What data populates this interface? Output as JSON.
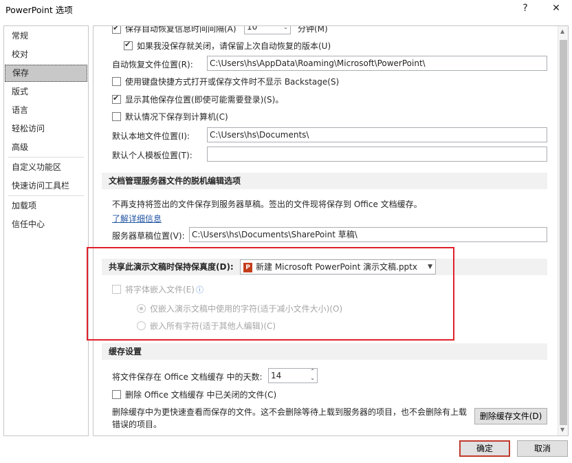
{
  "window": {
    "title": "PowerPoint 选项",
    "help": "?",
    "close": "✕"
  },
  "sidebar": {
    "items": [
      "常规",
      "校对",
      "保存",
      "版式",
      "语言",
      "轻松访问",
      "高级",
      "自定义功能区",
      "快速访问工具栏",
      "加载项",
      "信任中心"
    ],
    "selected": 2
  },
  "save": {
    "autorecover_label": "保存自动恢复信息时间间隔(A)",
    "autorecover_value": "10",
    "autorecover_unit": "分钟(M)",
    "keep_last_label": "如果我没保存就关闭，请保留上次自动恢复的版本(U)",
    "autorecover_location_label": "自动恢复文件位置(R):",
    "autorecover_location_value": "C:\\Users\\hs\\AppData\\Roaming\\Microsoft\\PowerPoint\\",
    "no_backstage_label": "使用键盘快捷方式打开或保存文件时不显示 Backstage(S)",
    "show_additional_label": "显示其他保存位置(即使可能需要登录)(S)。",
    "default_computer_label": "默认情况下保存到计算机(C)",
    "default_local_label": "默认本地文件位置(I):",
    "default_local_value": "C:\\Users\\hs\\Documents\\",
    "default_template_label": "默认个人模板位置(T):",
    "default_template_value": ""
  },
  "offline": {
    "heading": "文档管理服务器文件的脱机编辑选项",
    "desc": "不再支持将签出的文件保存到服务器草稿。签出的文件现将保存到 Office 文档缓存。",
    "link": "了解详细信息",
    "drafts_label": "服务器草稿位置(V):",
    "drafts_value": "C:\\Users\\hs\\Documents\\SharePoint 草稿\\"
  },
  "fidelity": {
    "heading": "共享此演示文稿时保持保真度(D):",
    "selected_file": "新建 Microsoft PowerPoint 演示文稿.pptx",
    "embed_label": "将字体嵌入文件(E)",
    "info_icon": "ⓘ",
    "embed_used_label": "仅嵌入演示文稿中使用的字符(适于减小文件大小)(O)",
    "embed_all_label": "嵌入所有字符(适于其他人编辑)(C)"
  },
  "cache": {
    "heading": "缓存设置",
    "days_label": "将文件保存在 Office 文档缓存 中的天数:",
    "days_value": "14",
    "delete_closed_label": "删除 Office 文档缓存 中已关闭的文件(C)",
    "desc_line1": "删除缓存中为更快速查看而保存的文件。这不会删除等待上载到服务器的项目，也不会删除有上载",
    "desc_line2": "错误的项目。",
    "delete_button": "删除缓存文件(D)"
  },
  "footer": {
    "ok": "确定",
    "cancel": "取消"
  },
  "colors": {
    "highlight": "#e0202a",
    "link": "#2255a4",
    "selected_nav": "#c8c8c8",
    "section_bg": "#f1f1f1",
    "pptx_icon": "#c43e1c"
  }
}
